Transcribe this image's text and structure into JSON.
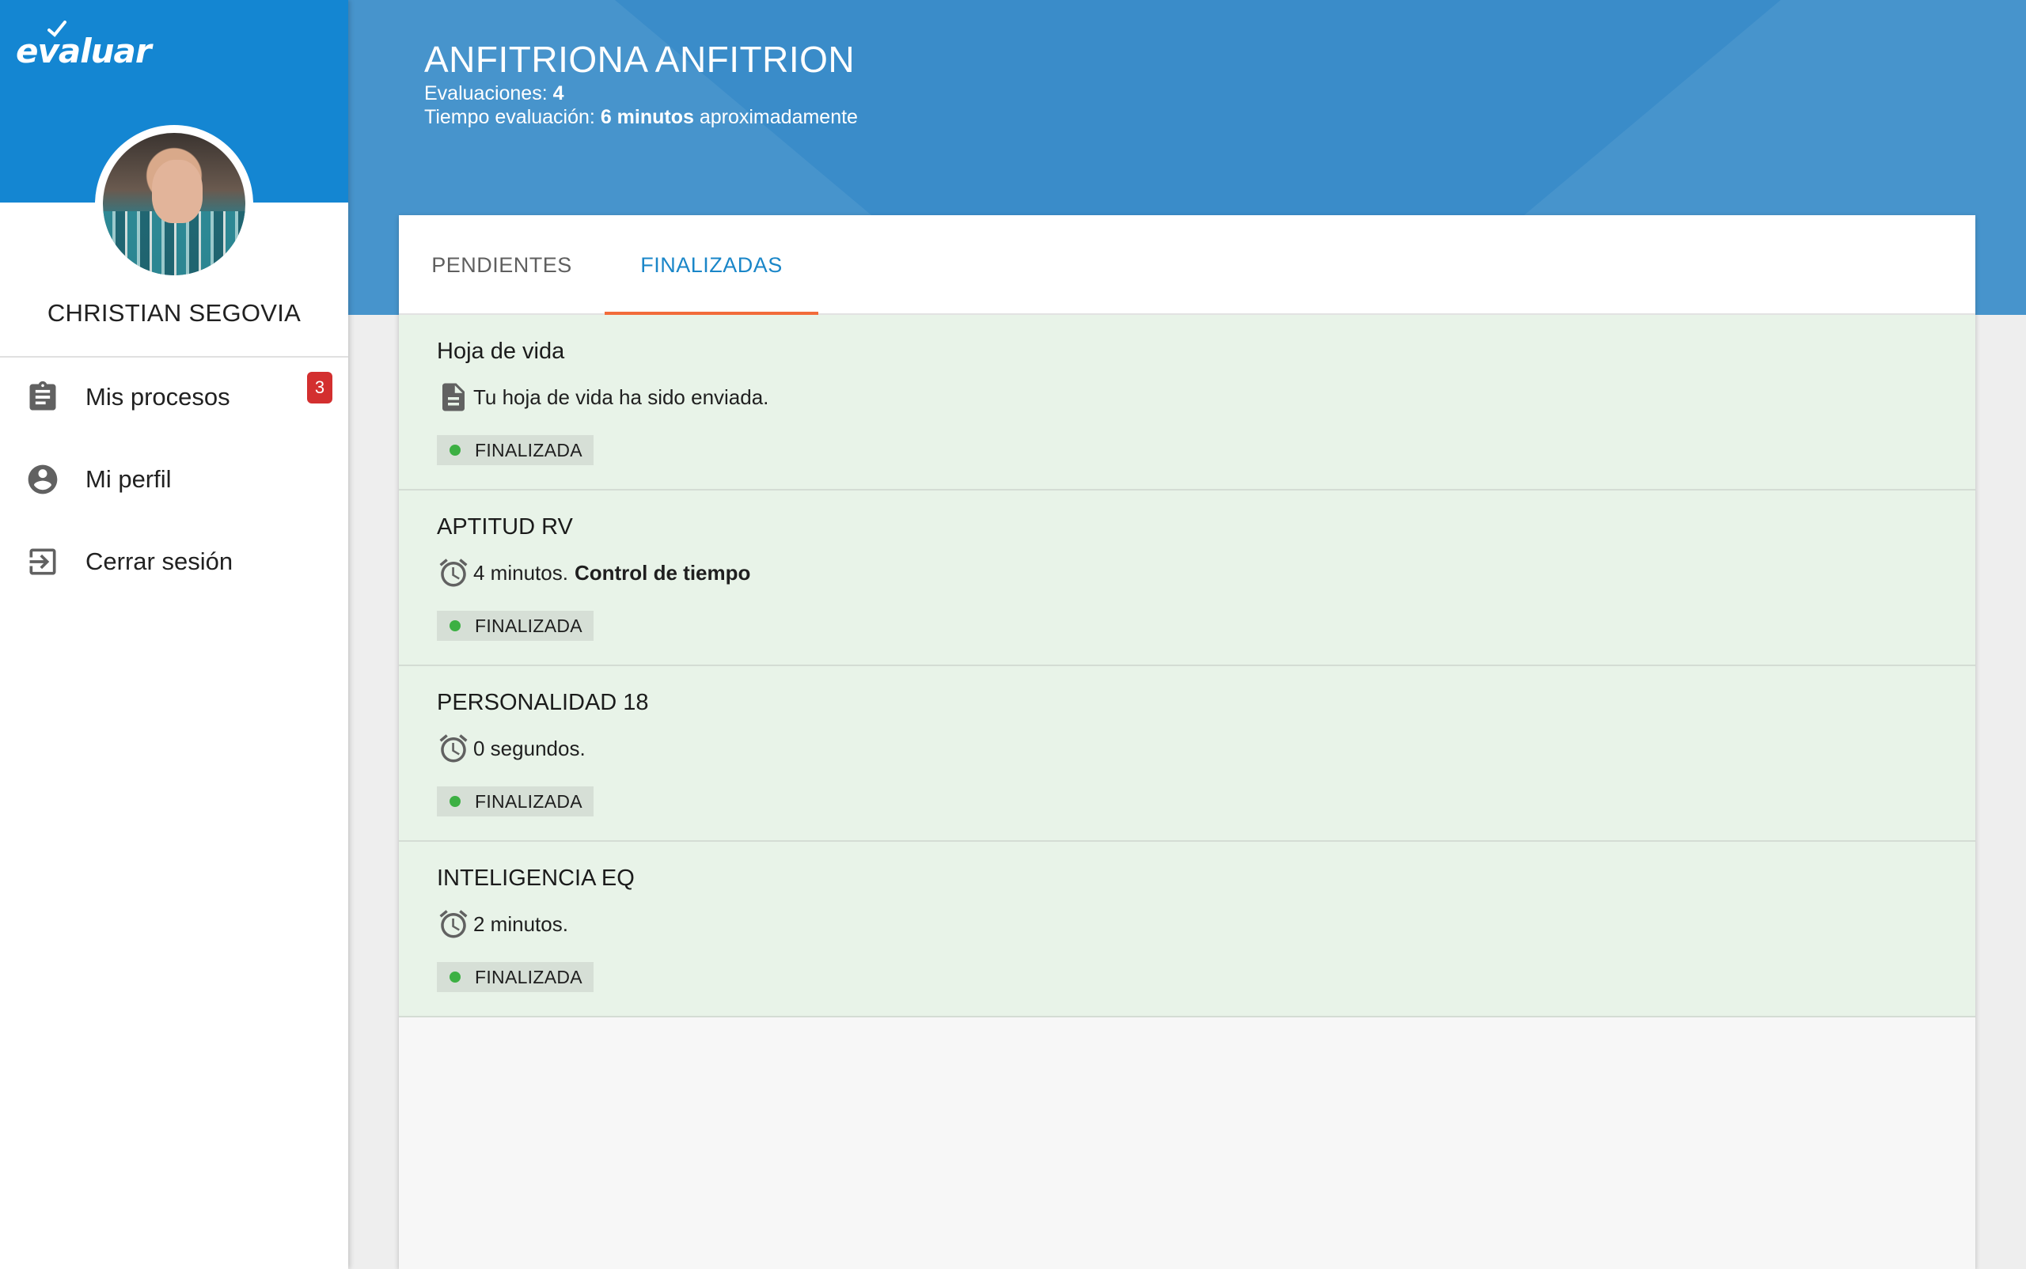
{
  "app": {
    "logo_text": "evaluar"
  },
  "user": {
    "name": "CHRISTIAN SEGOVIA"
  },
  "sidebar": {
    "items": [
      {
        "label": "Mis procesos",
        "icon": "clipboard-icon",
        "badge": "3"
      },
      {
        "label": "Mi perfil",
        "icon": "account-circle-icon"
      },
      {
        "label": "Cerrar sesión",
        "icon": "logout-icon"
      }
    ]
  },
  "header": {
    "title": "ANFITRIONA ANFITRION",
    "evaluations_label": "Evaluaciones:",
    "evaluations_value": "4",
    "time_label": "Tiempo evaluación:",
    "time_value": "6 minutos",
    "time_suffix": "aproximadamente"
  },
  "tabs": [
    {
      "label": "PENDIENTES",
      "active": false
    },
    {
      "label": "FINALIZADAS",
      "active": true
    }
  ],
  "evaluations": [
    {
      "title": "Hoja de vida",
      "icon": "document-icon",
      "text": "Tu hoja de vida ha sido enviada.",
      "extra": "",
      "status": "FINALIZADA"
    },
    {
      "title": "APTITUD RV",
      "icon": "alarm-clock-icon",
      "text": "4 minutos.",
      "extra": "Control de tiempo",
      "status": "FINALIZADA"
    },
    {
      "title": "PERSONALIDAD 18",
      "icon": "alarm-clock-icon",
      "text": "0 segundos.",
      "extra": "",
      "status": "FINALIZADA"
    },
    {
      "title": "INTELIGENCIA EQ",
      "icon": "alarm-clock-icon",
      "text": "2 minutos.",
      "extra": "",
      "status": "FINALIZADA"
    }
  ],
  "colors": {
    "brand_blue": "#1486d2",
    "banner_blue": "#3a8cc9",
    "active_tab": "#1a86c8",
    "tab_indicator": "#f26b3a",
    "finished_bg": "#e8f3e8",
    "status_dot": "#3cb043",
    "badge_red": "#d32f2f"
  }
}
